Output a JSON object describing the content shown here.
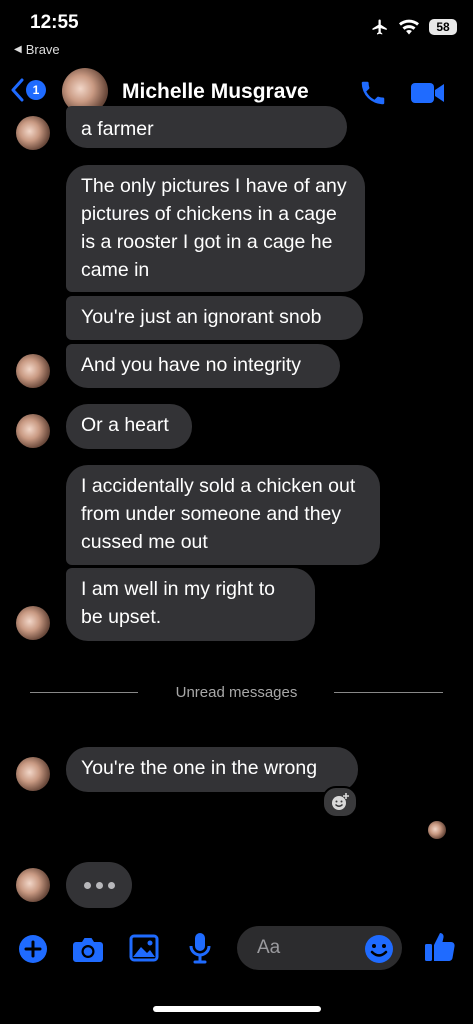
{
  "status_bar": {
    "time": "12:55",
    "back_app": "Brave",
    "battery": "58"
  },
  "header": {
    "unread_count": "1",
    "contact_name": "Michelle Musgrave"
  },
  "messages": [
    {
      "text": "a farmer"
    },
    {
      "text": "The only pictures I have of any pictures of chickens in a cage is a rooster I got in a cage he came in"
    },
    {
      "text": "You're just an ignorant snob"
    },
    {
      "text": "And you have no integrity"
    },
    {
      "text": "Or a heart"
    },
    {
      "text": "I accidentally sold a chicken out from under someone and they cussed me out"
    },
    {
      "text": "I am well in my right to be upset."
    },
    {
      "text": "You're the one in the wrong"
    }
  ],
  "divider": {
    "label": "Unread messages"
  },
  "composer": {
    "placeholder": "Aa"
  },
  "colors": {
    "accent": "#1f6bff",
    "bubble": "#333336",
    "background": "#000000"
  }
}
